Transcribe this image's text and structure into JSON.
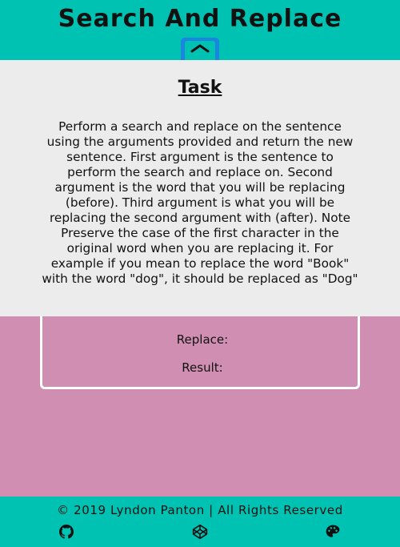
{
  "header": {
    "title": "Search And Replace"
  },
  "task": {
    "heading": "Task",
    "description": "Perform a search and replace on the sentence using the arguments provided and return the new sentence. First argument is the sentence to perform the search and replace on. Second argument is the word that you will be replacing (before). Third argument is what you will be replacing the second argument with (after). Note Preserve the case of the first character in the original word when you are replacing it. For example if you mean to replace the word \"Book\" with the word \"dog\", it should be replaced as \"Dog\""
  },
  "form": {
    "replace_label": "Replace:",
    "result_label": "Result:"
  },
  "footer": {
    "copyright": "© 2019 Lyndon Panton | All Rights Reserved",
    "icons": [
      "github-icon",
      "codepen-icon",
      "palette-icon"
    ]
  },
  "colors": {
    "header_bg": "#00c2b2",
    "page_bg": "#d08fb2",
    "panel_bg": "#ececec",
    "tab_accent": "#1a86e0"
  }
}
